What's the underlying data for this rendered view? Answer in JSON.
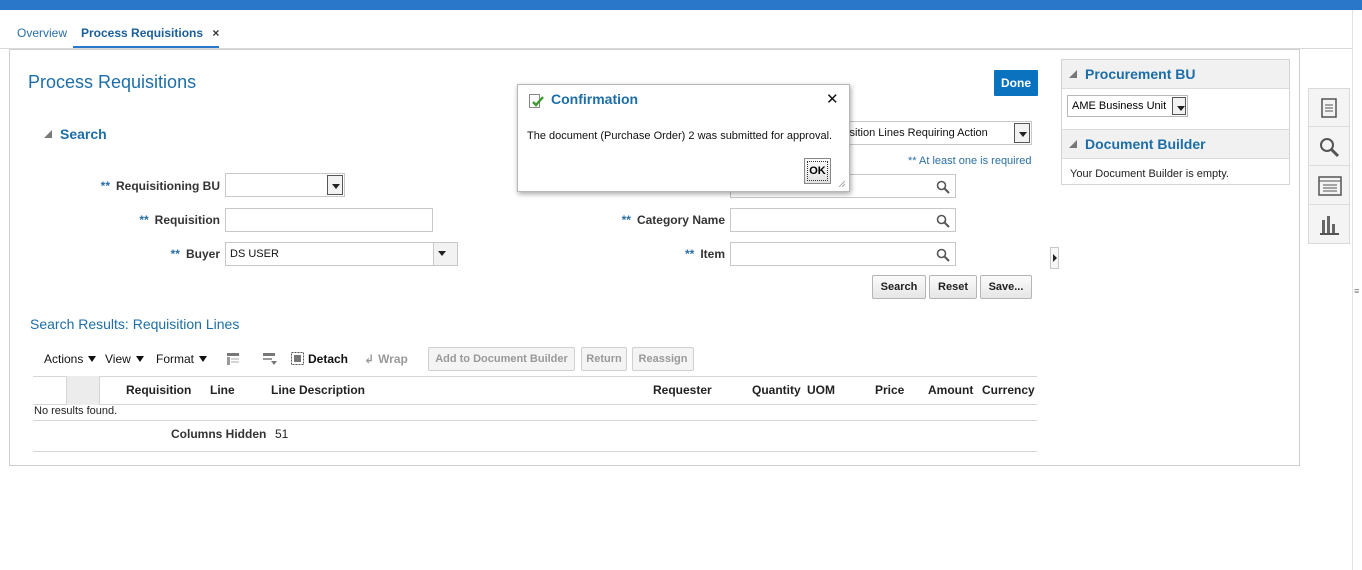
{
  "tabs": [
    {
      "label": "Overview"
    },
    {
      "label": "Process Requisitions",
      "close": "×"
    }
  ],
  "page": {
    "title": "Process Requisitions",
    "done_label": "Done"
  },
  "search": {
    "header": "Search",
    "required_marker": "**",
    "hint": "** At least one is required",
    "fields": {
      "requisitioning_bu": {
        "label": "Requisitioning BU",
        "value": ""
      },
      "requisition": {
        "label": "Requisition",
        "value": ""
      },
      "buyer": {
        "label": "Buyer",
        "value": "DS USER"
      },
      "category_name": {
        "label": "Category Name",
        "value": ""
      },
      "item": {
        "label": "Item",
        "value": ""
      },
      "saved_search": {
        "value": "uisition Lines Requiring Action"
      }
    },
    "buttons": {
      "search": "Search",
      "reset": "Reset",
      "save": "Save..."
    }
  },
  "results": {
    "title": "Search Results: Requisition Lines",
    "toolbar": {
      "actions": "Actions",
      "view": "View",
      "format": "Format",
      "detach": "Detach",
      "wrap": "Wrap",
      "add_to_builder": "Add to Document Builder",
      "return": "Return",
      "reassign": "Reassign"
    },
    "columns": [
      "Requisition",
      "Line",
      "Line Description",
      "Requester",
      "Quantity",
      "UOM",
      "Price",
      "Amount",
      "Currency"
    ],
    "empty_text": "No results found.",
    "columns_hidden_label": "Columns Hidden",
    "columns_hidden_value": "51"
  },
  "right_panel": {
    "procurement_bu": {
      "title": "Procurement BU",
      "value": "AME Business Unit"
    },
    "document_builder": {
      "title": "Document Builder",
      "empty_text": "Your Document Builder is empty."
    }
  },
  "sidebar": {
    "icons": [
      "document-icon",
      "search-icon",
      "list-icon",
      "chart-icon"
    ]
  },
  "dialog": {
    "title": "Confirmation",
    "message": "The document (Purchase Order) 2 was submitted for approval.",
    "ok_label": "OK",
    "close": "✕"
  },
  "colors": {
    "brand_blue": "#2a76c9",
    "link_blue": "#1d6ea8",
    "done_button": "#0b72c0"
  }
}
